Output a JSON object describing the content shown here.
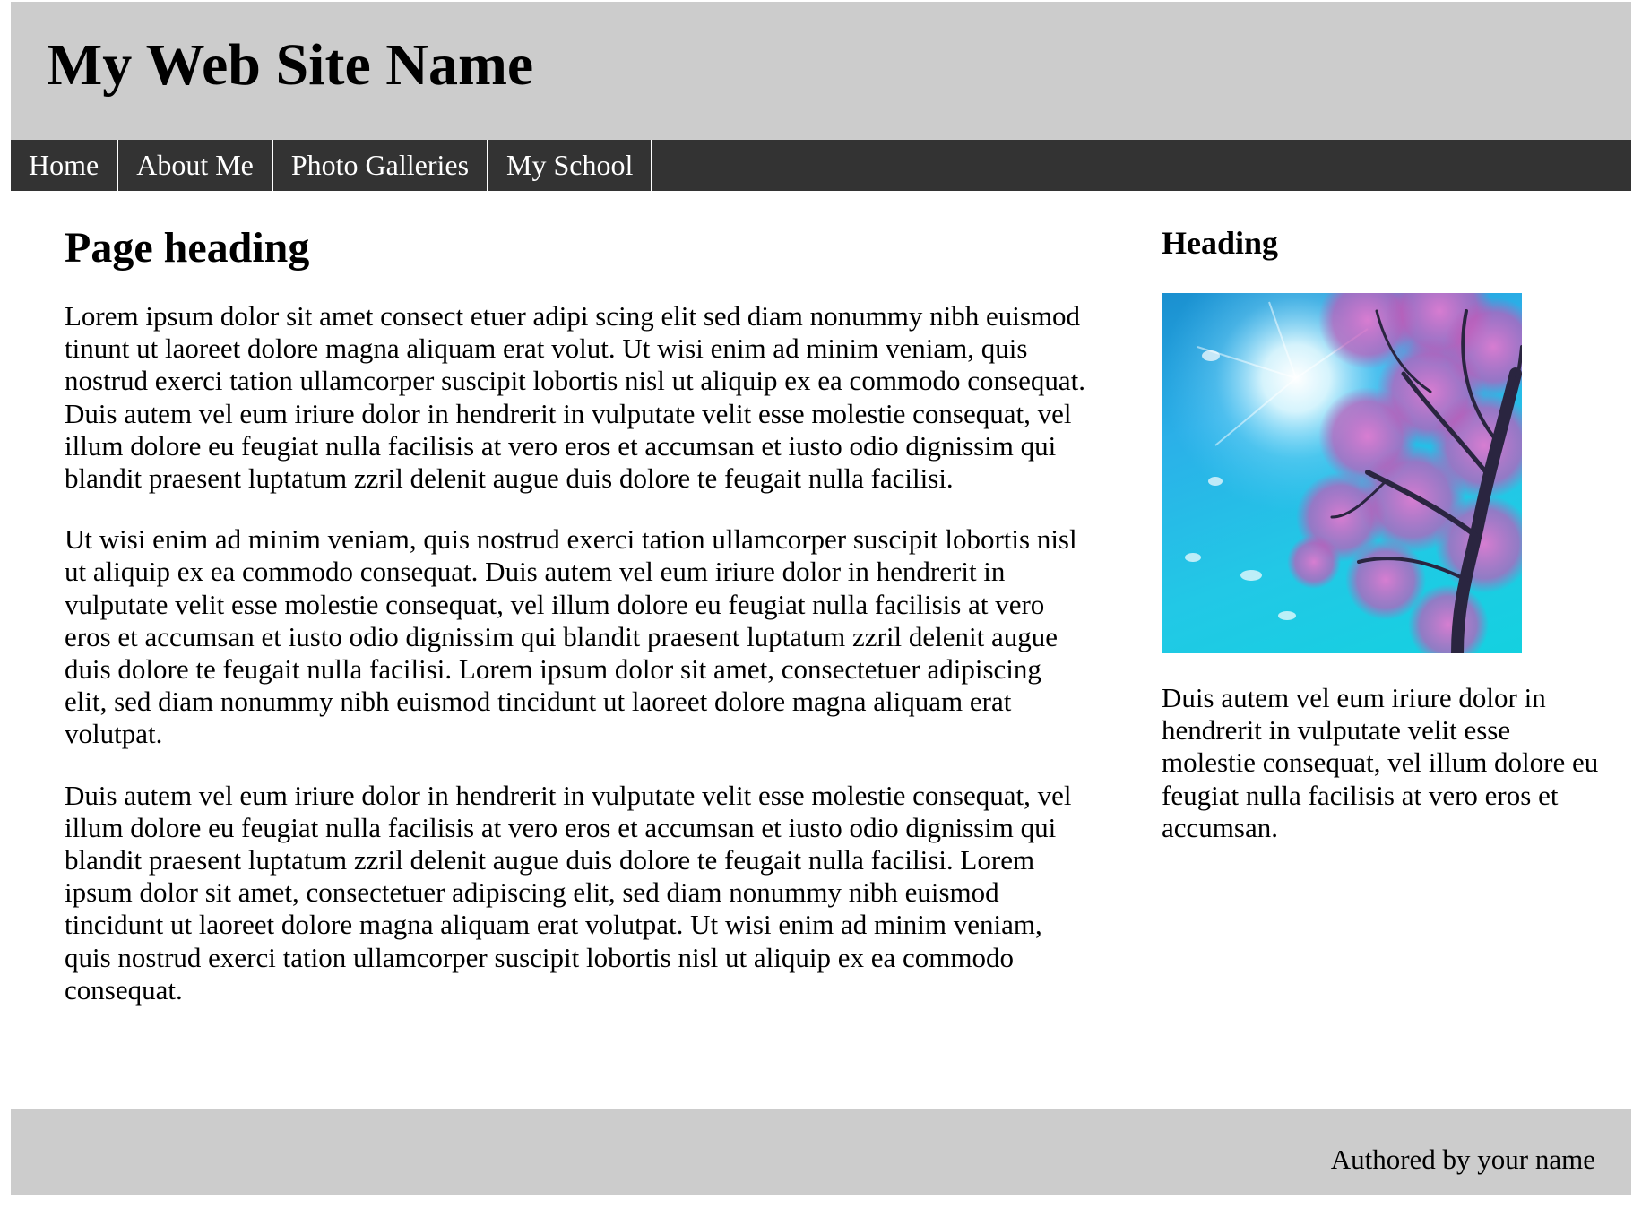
{
  "header": {
    "site_title": "My Web Site Name"
  },
  "nav": {
    "items": [
      {
        "label": "Home"
      },
      {
        "label": "About Me"
      },
      {
        "label": "Photo Galleries"
      },
      {
        "label": "My School"
      }
    ]
  },
  "main": {
    "heading": "Page heading",
    "paragraphs": [
      "Lorem ipsum dolor sit amet consect etuer adipi scing elit sed diam nonummy nibh euismod tinunt ut laoreet dolore magna aliquam erat volut. Ut wisi enim ad minim veniam, quis nostrud exerci tation ullamcorper suscipit lobortis nisl ut aliquip ex ea commodo consequat. Duis autem vel eum iriure dolor in hendrerit in vulputate velit esse molestie consequat, vel illum dolore eu feugiat nulla facilisis at vero eros et accumsan et iusto odio dignissim qui blandit praesent luptatum zzril delenit augue duis dolore te feugait nulla facilisi.",
      "Ut wisi enim ad minim veniam, quis nostrud exerci tation ullamcorper suscipit lobortis nisl ut aliquip ex ea commodo consequat. Duis autem vel eum iriure dolor in hendrerit in vulputate velit esse molestie consequat, vel illum dolore eu feugiat nulla facilisis at vero eros et accumsan et iusto odio dignissim qui blandit praesent luptatum zzril delenit augue duis dolore te feugait nulla facilisi. Lorem ipsum dolor sit amet, consectetuer adipiscing elit, sed diam nonummy nibh euismod tincidunt ut laoreet dolore magna aliquam erat volutpat.",
      "Duis autem vel eum iriure dolor in hendrerit in vulputate velit esse molestie consequat, vel illum dolore eu feugiat nulla facilisis at vero eros et accumsan et iusto odio dignissim qui blandit praesent luptatum zzril delenit augue duis dolore te feugait nulla facilisi. Lorem ipsum dolor sit amet, consectetuer adipiscing elit, sed diam nonummy nibh euismod tincidunt ut laoreet dolore magna aliquam erat volutpat. Ut wisi enim ad minim veniam, quis nostrud exerci tation ullamcorper suscipit lobortis nisl ut aliquip ex ea commodo consequat."
    ]
  },
  "sidebar": {
    "heading": "Heading",
    "image_icon": "blossom-tree-photo",
    "text": "Duis autem vel eum iriure dolor in hendrerit in vulputate velit esse molestie consequat, vel illum dolore eu feugiat nulla facilisis at vero eros et accumsan."
  },
  "footer": {
    "text": "Authored by your name"
  },
  "colors": {
    "header_bg": "#cccccc",
    "nav_bg": "#333333",
    "nav_text": "#ffffff",
    "footer_bg": "#cccccc"
  }
}
